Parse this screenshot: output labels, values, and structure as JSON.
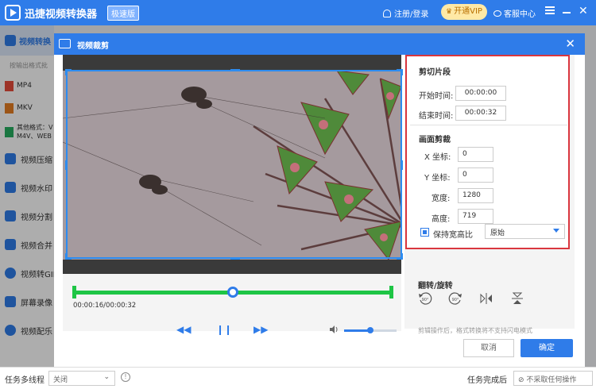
{
  "app": {
    "title": "迅捷视频转换器",
    "badge": "极速版",
    "login_label": "注册/登录",
    "vip_label": "开通VIP",
    "service_label": "客服中心",
    "accent": "#2f7ce9"
  },
  "sidebar": {
    "active_label": "视频转换",
    "sub_label": "按输出格式批",
    "formats": [
      {
        "label": "MP4"
      },
      {
        "label": "MKV"
      },
      {
        "label": "其他格式：V M4V、WEB"
      }
    ],
    "items": [
      {
        "label": "视频压缩",
        "icon": "compress-icon"
      },
      {
        "label": "视频水印",
        "icon": "watermark-icon"
      },
      {
        "label": "视频分割",
        "icon": "split-icon"
      },
      {
        "label": "视频合并",
        "icon": "merge-icon"
      },
      {
        "label": "视频转GIF",
        "icon": "gif-icon"
      },
      {
        "label": "屏幕录像",
        "icon": "record-icon"
      },
      {
        "label": "视频配乐",
        "icon": "music-icon"
      }
    ]
  },
  "bottom_bar": {
    "multithread_label": "任务多线程",
    "multithread_value": "关闭",
    "done_label": "任务完成后",
    "done_value": "不采取任何操作"
  },
  "dialog": {
    "title": "视频裁剪",
    "player": {
      "time_display": "00:00:16/00:00:32",
      "progress": 0.5,
      "volume": 0.5
    },
    "segment": {
      "title": "剪切片段",
      "start_label": "开始时间:",
      "start_value": "00:00:00",
      "end_label": "结束时间:",
      "end_value": "00:00:32"
    },
    "crop": {
      "title": "画面剪裁",
      "x_label": "X 坐标:",
      "x_value": "0",
      "y_label": "Y 坐标:",
      "y_value": "0",
      "width_label": "宽度:",
      "width_value": "1280",
      "height_label": "高度:",
      "height_value": "719",
      "keep_ratio_label": "保持宽高比",
      "keep_ratio_checked": true,
      "ratio_value": "原始"
    },
    "rotate": {
      "title": "翻转/旋转",
      "buttons": [
        {
          "label": "90°",
          "icon": "rotate-left-icon"
        },
        {
          "label": "90°",
          "icon": "rotate-right-icon"
        },
        {
          "icon": "flip-horizontal-icon"
        },
        {
          "icon": "flip-vertical-icon"
        }
      ]
    },
    "note": "剪辑操作后，格式转换将不支持闪电模式",
    "cancel_label": "取消",
    "ok_label": "确定"
  }
}
